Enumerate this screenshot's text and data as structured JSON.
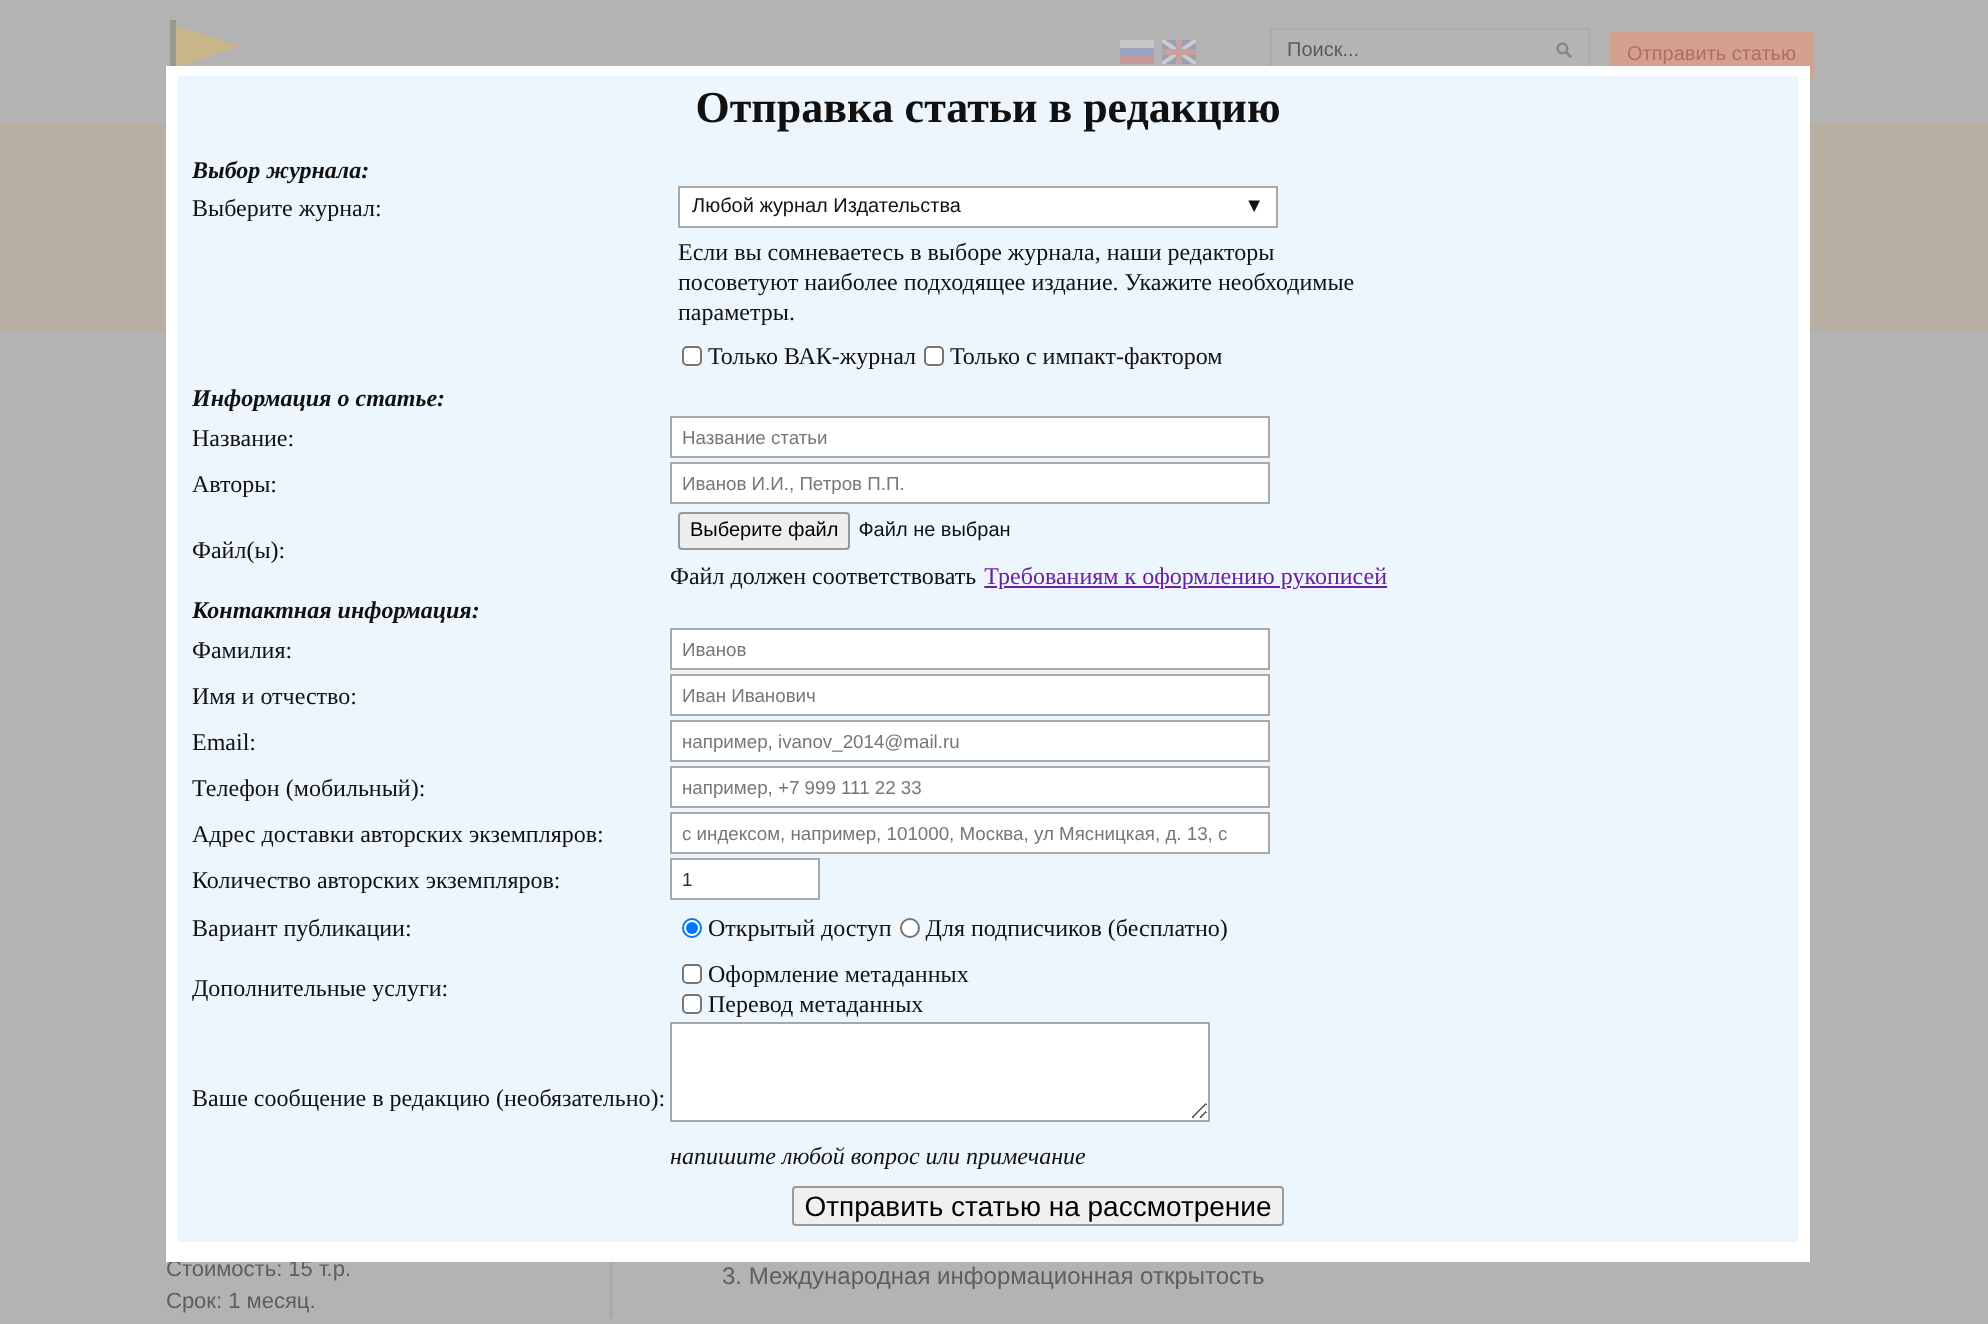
{
  "background": {
    "search_placeholder": "Поиск...",
    "submit_button": "Отправить статью",
    "cost": "Стоимость: 15 т.р.",
    "term": "Срок: 1 месяц.",
    "list_item": "3. Международная информационная открытость"
  },
  "modal": {
    "title": "Отправка статьи в редакцию",
    "sections": [
      {
        "heading": "Выбор журнала:",
        "rows": [
          {
            "kind": "select",
            "label": "Выберите журнал:",
            "value": "Любой журнал Издательства",
            "caret": "▼"
          },
          {
            "kind": "note",
            "text": "Если вы сомневаетесь в выборе журнала, наши редакторы посоветуют наиболее подходящее издание. Укажите необходимые параметры."
          },
          {
            "kind": "checks",
            "options": [
              {
                "label": "Только ВАК-журнал",
                "checked": false
              },
              {
                "label": "Только с импакт-фактором",
                "checked": false
              }
            ]
          }
        ]
      },
      {
        "heading": "Информация о статье:",
        "rows": [
          {
            "kind": "input",
            "label": "Название:",
            "placeholder": "Название статьи"
          },
          {
            "kind": "input",
            "label": "Авторы:",
            "placeholder": "Иванов И.И., Петров П.П."
          },
          {
            "kind": "file",
            "label": "Файл(ы):",
            "button": "Выберите файл",
            "status": "Файл не выбран",
            "note": "Файл должен соответствовать",
            "link": "Требованиям к оформлению рукописей"
          }
        ]
      },
      {
        "heading": "Контактная информация:",
        "rows": [
          {
            "kind": "input",
            "label": "Фамилия:",
            "placeholder": "Иванов"
          },
          {
            "kind": "input",
            "label": "Имя и отчество:",
            "placeholder": "Иван Иванович"
          },
          {
            "kind": "input",
            "label": "Email:",
            "placeholder": "например, ivanov_2014@mail.ru"
          },
          {
            "kind": "input",
            "label": "Телефон (мобильный):",
            "placeholder": "например, +7 999 111 22 33"
          },
          {
            "kind": "input",
            "label": "Адрес доставки авторских экземпляров:",
            "placeholder": "с индексом, например, 101000, Москва, ул Мясницкая, д. 13, с"
          },
          {
            "kind": "number",
            "label": "Количество авторских экземпляров:",
            "value": "1"
          },
          {
            "kind": "radios",
            "label": "Вариант публикации:",
            "options": [
              {
                "label": "Открытый доступ",
                "selected": true
              },
              {
                "label": "Для подписчиков (бесплатно)",
                "selected": false
              }
            ]
          },
          {
            "kind": "checklist",
            "label": "Дополнительные услуги:",
            "options": [
              {
                "label": "Оформление метаданных",
                "checked": false
              },
              {
                "label": "Перевод метаданных",
                "checked": false
              }
            ]
          },
          {
            "kind": "textarea",
            "label": "Ваше сообщение в редакцию (необязательно):",
            "hint": "напишите любой вопрос или примечание"
          }
        ]
      }
    ],
    "submit": "Отправить статью на рассмотрение"
  }
}
